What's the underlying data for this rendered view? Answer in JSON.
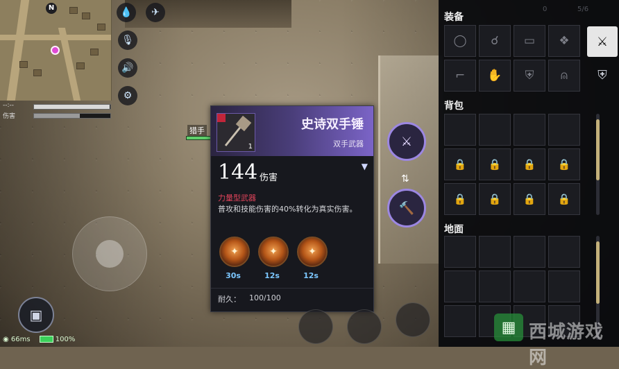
{
  "minimap": {
    "north_label": "N"
  },
  "hud": {
    "stamina_label": "--:--",
    "damage_label": "伤害",
    "stamina_fraction": 0.99,
    "damage_fraction": 0.6,
    "ping": "66ms",
    "battery": "100%",
    "npc_name": "猎手"
  },
  "tooltip": {
    "name": "史诗双手锤",
    "category": "双手武器",
    "quantity": "1",
    "damage_value": "144",
    "damage_unit": "伤害",
    "weapon_type": "力量型武器",
    "description": "普攻和技能伤害的40%转化为真实伤害。",
    "skills": [
      {
        "cooldown": "30s",
        "icon": "hammer-slam-icon"
      },
      {
        "cooldown": "12s",
        "icon": "hammer-swing-icon"
      },
      {
        "cooldown": "12s",
        "icon": "hammer-strike-icon"
      }
    ],
    "durability_label": "耐久：",
    "durability_value": "100/100",
    "accent": "#7b64c7"
  },
  "inventory": {
    "equipment_title": "装备",
    "backpack_title": "背包",
    "ground_title": "地面",
    "top_left_stat": "0",
    "top_right_stat": "5/6",
    "equipment_slots": [
      "ring-icon",
      "necklace-icon",
      "belt-icon",
      "cape-icon",
      "boots-icon",
      "gloves-icon",
      "chest-armor-icon",
      "helmet-icon"
    ]
  },
  "watermark": {
    "text": "西城游戏网"
  }
}
